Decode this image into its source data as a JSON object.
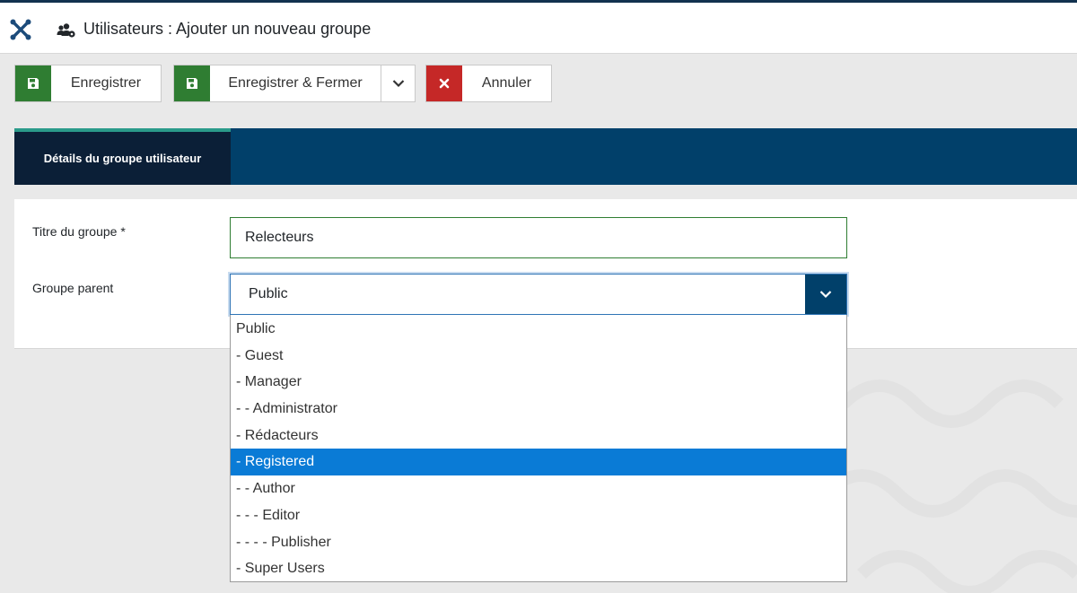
{
  "header": {
    "logo_icon": "joomla-logo-icon",
    "title_icon": "users-cog-icon",
    "title": "Utilisateurs : Ajouter un nouveau groupe"
  },
  "toolbar": {
    "save_label": "Enregistrer",
    "save_close_label": "Enregistrer & Fermer",
    "cancel_label": "Annuler",
    "save_icon": "floppy-disk-icon",
    "cancel_icon": "close-icon",
    "dropdown_icon": "chevron-down-icon"
  },
  "tabs": [
    {
      "label": "Détails du groupe utilisateur",
      "active": true
    }
  ],
  "form": {
    "title_label": "Titre du groupe *",
    "title_value": "Relecteurs",
    "parent_label": "Groupe parent",
    "parent_value": "Public",
    "parent_options": [
      "Public",
      "- Guest",
      "- Manager",
      "- - Administrator",
      "- Rédacteurs",
      "- Registered",
      "- - Author",
      "- - - Editor",
      "- - - - Publisher",
      "- Super Users"
    ],
    "highlighted_option": "- Registered"
  },
  "colors": {
    "header_dark": "#12324f",
    "tabbar": "#01406a",
    "tab_active": "#0b1f37",
    "tab_accent": "#2b9b8a",
    "save_green": "#2f7d32",
    "cancel_red": "#c52827",
    "option_highlight": "#0a7bd6"
  }
}
